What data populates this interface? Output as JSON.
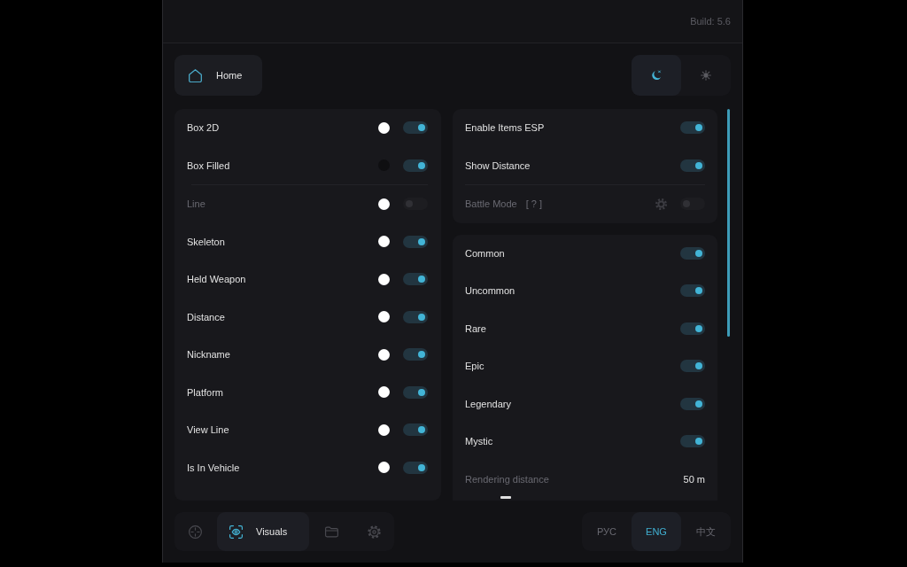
{
  "header": {
    "build": "Build: 5.6"
  },
  "home_button": {
    "label": "Home"
  },
  "theme_buttons": [
    {
      "kind": "dark",
      "selected": true
    },
    {
      "kind": "light",
      "selected": false
    }
  ],
  "left_panel": {
    "groups": [
      {
        "rows": [
          {
            "label": "Box 2D",
            "color": "#ffffff",
            "on": true,
            "disabled": false
          },
          {
            "label": "Box Filled",
            "color": "#0f0f11",
            "on": true,
            "disabled": false
          }
        ]
      },
      {
        "rows": [
          {
            "label": "Line",
            "color": "#ffffff",
            "on": false,
            "disabled": true
          },
          {
            "label": "Skeleton",
            "color": "#ffffff",
            "on": true,
            "disabled": false
          },
          {
            "label": "Held Weapon",
            "color": "#ffffff",
            "on": true,
            "disabled": false
          },
          {
            "label": "Distance",
            "color": "#ffffff",
            "on": true,
            "disabled": false
          },
          {
            "label": "Nickname",
            "color": "#ffffff",
            "on": true,
            "disabled": false
          },
          {
            "label": "Platform",
            "color": "#ffffff",
            "on": true,
            "disabled": false
          },
          {
            "label": "View Line",
            "color": "#ffffff",
            "on": true,
            "disabled": false
          },
          {
            "label": "Is In Vehicle",
            "color": "#ffffff",
            "on": true,
            "disabled": false
          }
        ]
      }
    ]
  },
  "right_panel": {
    "cards": [
      {
        "groups": [
          {
            "rows": [
              {
                "kind": "toggle",
                "label": "Enable Items ESP",
                "on": true,
                "disabled": false
              },
              {
                "kind": "toggle",
                "label": "Show Distance",
                "on": true,
                "disabled": false
              }
            ]
          },
          {
            "rows": [
              {
                "kind": "toggle_settings",
                "label": "Battle Mode",
                "hint": "[ ? ]",
                "on": false,
                "disabled": true
              }
            ]
          }
        ]
      },
      {
        "groups": [
          {
            "rows": [
              {
                "kind": "toggle",
                "label": "Common",
                "on": true
              },
              {
                "kind": "toggle",
                "label": "Uncommon",
                "on": true
              },
              {
                "kind": "toggle",
                "label": "Rare",
                "on": true
              },
              {
                "kind": "toggle",
                "label": "Epic",
                "on": true
              },
              {
                "kind": "toggle",
                "label": "Legendary",
                "on": true
              },
              {
                "kind": "toggle",
                "label": "Mystic",
                "on": true
              }
            ]
          }
        ],
        "rendering_distance": {
          "label": "Rendering distance",
          "value": "50 m"
        }
      }
    ]
  },
  "bottom_nav": [
    {
      "kind": "crosshair",
      "selected": false
    },
    {
      "kind": "visuals",
      "label": "Visuals",
      "selected": true
    },
    {
      "kind": "folder",
      "selected": false
    },
    {
      "kind": "settings",
      "selected": false
    }
  ],
  "languages": [
    {
      "label": "РУС",
      "selected": false
    },
    {
      "label": "ENG",
      "selected": true
    },
    {
      "label": "中文",
      "selected": false
    }
  ]
}
